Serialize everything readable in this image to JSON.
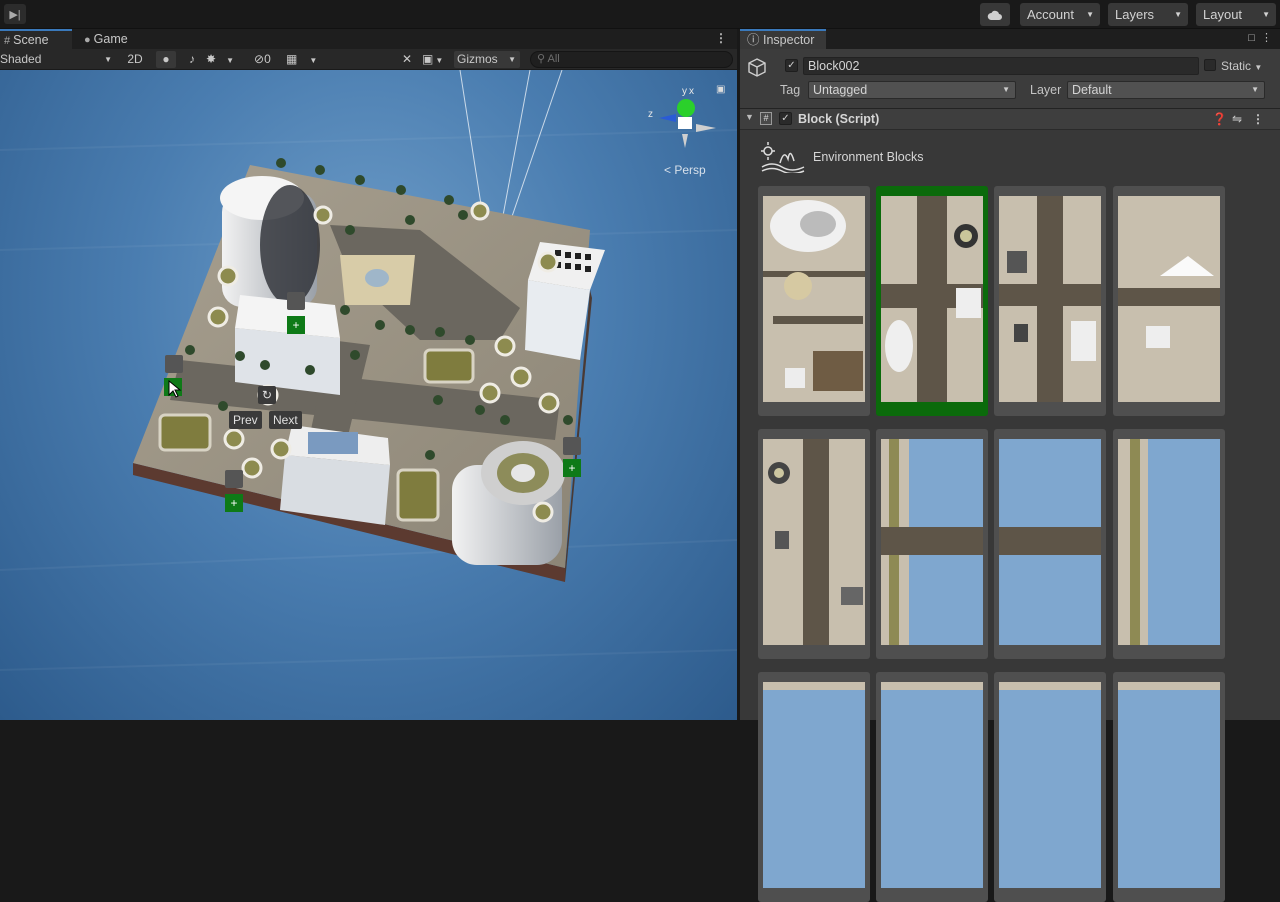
{
  "toolbar": {
    "account_label": "Account",
    "layers_label": "Layers",
    "layout_label": "Layout"
  },
  "scene": {
    "tab_scene": "Scene",
    "tab_game": "Game",
    "shading_mode": "Shaded",
    "mode_2d": "2D",
    "hidden_count": "0",
    "gizmos_label": "Gizmos",
    "search_placeholder": "All",
    "persp_label": "< Persp",
    "axis_y": "y",
    "axis_x": "x",
    "axis_z": "z",
    "prev_label": "Prev",
    "next_label": "Next",
    "plus_glyph": "+"
  },
  "inspector": {
    "tab_label": "Inspector",
    "object_name": "Block002",
    "static_label": "Static",
    "tag_label": "Tag",
    "tag_value": "Untagged",
    "layer_label": "Layer",
    "layer_value": "Default",
    "component_title": "Block (Script)",
    "env_label": "Environment Blocks",
    "selected_block_index": 1,
    "blocks": [
      {
        "kind": "park-corner",
        "selected": false
      },
      {
        "kind": "road-cross-tower",
        "selected": true
      },
      {
        "kind": "road-cross",
        "selected": false
      },
      {
        "kind": "road-t",
        "selected": false
      },
      {
        "kind": "road-vertical",
        "selected": false
      },
      {
        "kind": "water-cross",
        "selected": false
      },
      {
        "kind": "water-bridge",
        "selected": false
      },
      {
        "kind": "water-edge",
        "selected": false
      },
      {
        "kind": "partial",
        "selected": false
      },
      {
        "kind": "partial",
        "selected": false
      },
      {
        "kind": "partial",
        "selected": false
      },
      {
        "kind": "partial",
        "selected": false
      }
    ]
  },
  "colors": {
    "accent": "#3a79bb",
    "selected_green": "#0b6a0b",
    "add_green": "#0e7a17"
  }
}
